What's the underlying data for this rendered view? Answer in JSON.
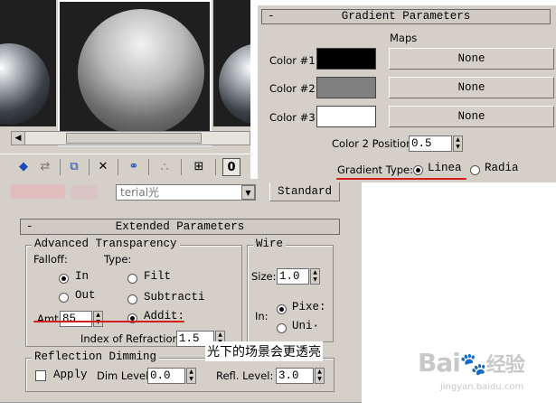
{
  "gradient_params": {
    "title": "Gradient Parameters",
    "collapse": "-",
    "maps_header": "Maps",
    "colors": [
      {
        "label": "Color #1",
        "swatch": "#000000",
        "map": "None"
      },
      {
        "label": "Color #2",
        "swatch": "#808080",
        "map": "None"
      },
      {
        "label": "Color #3",
        "swatch": "#ffffff",
        "map": "None"
      }
    ],
    "color2_position_label": "Color 2 Position:",
    "color2_position_value": "0.5",
    "gradient_type_label": "Gradient Type:",
    "gradient_type_options": [
      "Linea",
      "Radia"
    ],
    "gradient_type_selected": "Linea"
  },
  "material_bar": {
    "name_value": "terial光",
    "type_button": "Standard"
  },
  "extended_params": {
    "title": "Extended Parameters",
    "collapse": "-",
    "advanced_transparency": {
      "title": "Advanced Transparency",
      "falloff_label": "Falloff:",
      "falloff_options": [
        "In",
        "Out"
      ],
      "falloff_selected": "In",
      "type_label": "Type:",
      "type_options": [
        "Filt",
        "Subtracti",
        "Addit:"
      ],
      "type_selected": "Addit:",
      "amt_label": "Amt:",
      "amt_value": "85",
      "ior_label": "Index of Refraction:",
      "ior_value": "1.5"
    },
    "wire": {
      "title": "Wire",
      "size_label": "Size:",
      "size_value": "1.0",
      "in_label": "In:",
      "in_options": [
        "Pixe:",
        "Uni·"
      ],
      "in_selected": "Pixe:"
    },
    "reflection_dimming": {
      "title": "Reflection Dimming",
      "apply_label": "Apply",
      "apply_checked": false,
      "dim_level_label": "Dim Level:",
      "dim_level_value": "0.0",
      "refl_level_label": "Refl. Level:",
      "refl_level_value": "3.0"
    }
  },
  "annotation": {
    "caption": "光下的场景会更透亮",
    "underline_color": "#d61d1d"
  },
  "watermark": {
    "brand": "Bai",
    "brand_tail": "经验",
    "url": "jingyan.baidu.com"
  }
}
